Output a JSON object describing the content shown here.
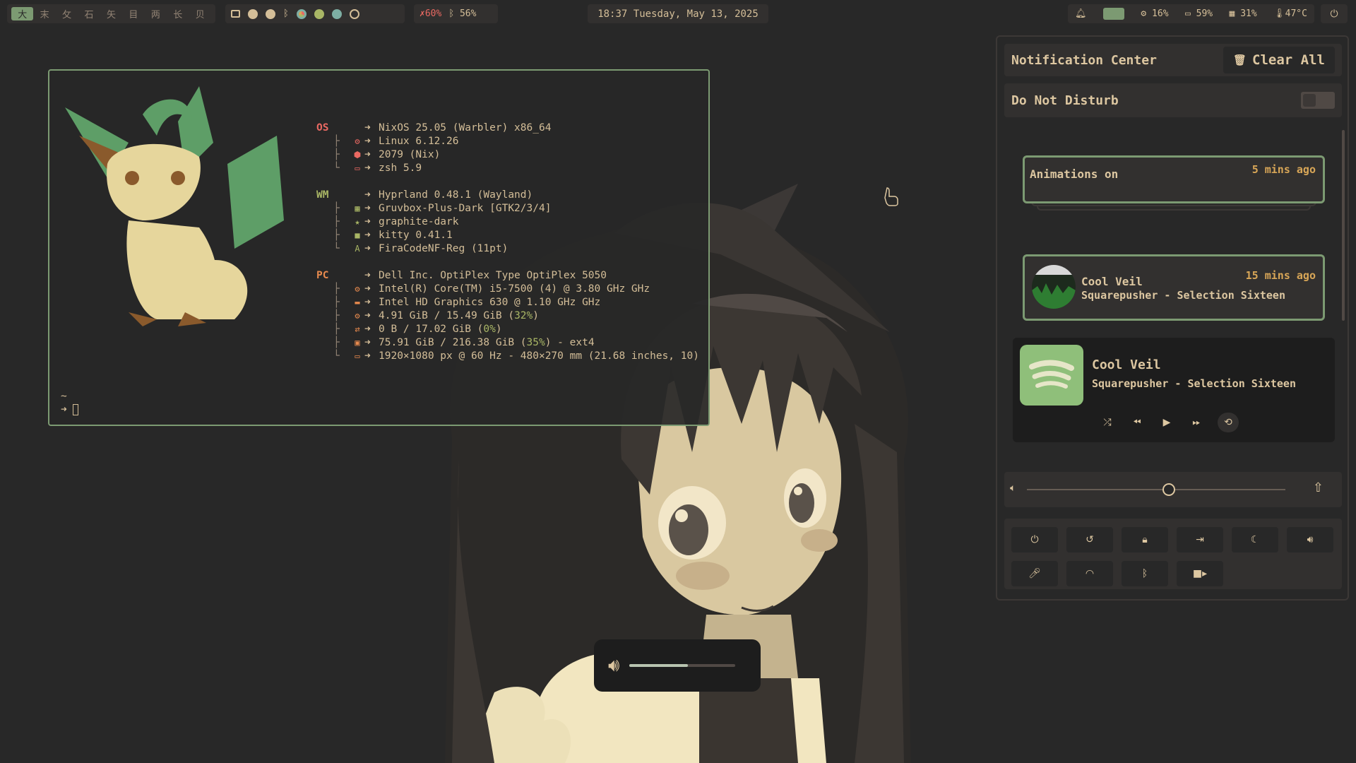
{
  "topbar": {
    "workspaces": [
      "大",
      "末",
      "攵",
      "石",
      "矢",
      "目",
      "两",
      "长",
      "贝"
    ],
    "active_workspace": 0,
    "tray_icons": [
      "window-icon",
      "obs-icon",
      "github-icon",
      "bluetooth-icon",
      "chrome-icon",
      "spotify-icon",
      "network-icon",
      "steam-icon"
    ],
    "mic_percent": "60%",
    "bluetooth_percent": "56%",
    "clock": "18:37 Tuesday, May 13, 2025",
    "cpu": "16%",
    "disk": "59%",
    "memory": "31%",
    "temperature": "47°C",
    "colors": {
      "accent": "#7c9a72",
      "mic_muted": "#ea6962"
    }
  },
  "terminal": {
    "sections": [
      {
        "key": "OS",
        "rows": [
          {
            "icon": "",
            "value": "NixOS 25.05 (Warbler) x86_64"
          },
          {
            "icon": "⚙",
            "value": "Linux 6.12.26"
          },
          {
            "icon": "⬢",
            "value": "2079 (Nix)"
          },
          {
            "icon": "▭",
            "value": "zsh 5.9"
          }
        ]
      },
      {
        "key": "WM",
        "rows": [
          {
            "icon": "",
            "value": "Hyprland 0.48.1 (Wayland)"
          },
          {
            "icon": "▦",
            "value": "Gruvbox-Plus-Dark [GTK2/3/4]"
          },
          {
            "icon": "★",
            "value": "graphite-dark"
          },
          {
            "icon": "■",
            "value": "kitty 0.41.1"
          },
          {
            "icon": "A",
            "value": "FiraCodeNF-Reg (11pt)"
          }
        ]
      },
      {
        "key": "PC",
        "rows": [
          {
            "icon": "",
            "value": "Dell Inc. OptiPlex Type OptiPlex 5050"
          },
          {
            "icon": "⚙",
            "value": "Intel(R) Core(TM) i5-7500 (4) @ 3.80 GHz GHz"
          },
          {
            "icon": "▬",
            "value": "Intel HD Graphics 630 @ 1.10 GHz GHz"
          },
          {
            "icon": "⚙",
            "value_pre": "4.91 GiB / 15.49 GiB (",
            "value_hl": "32%",
            "value_post": ")"
          },
          {
            "icon": "⇄",
            "value_pre": "0 B / 17.02 GiB (",
            "value_hl": "0%",
            "value_post": ")"
          },
          {
            "icon": "▣",
            "value_pre": "75.91 GiB / 216.38 GiB (",
            "value_hl": "35%",
            "value_post": ") - ext4"
          },
          {
            "icon": "▭",
            "value": "1920×1080 px @ 60 Hz - 480×270 mm (21.68 inches, 10)"
          }
        ]
      }
    ],
    "prompt_dir": "~",
    "prompt_symbol": "➜"
  },
  "osd": {
    "volume_fraction": 0.55
  },
  "notification_center": {
    "title": "Notification Center",
    "clear_all": "Clear All",
    "dnd_label": "Do Not Disturb",
    "dnd_on": false,
    "notifications": [
      {
        "title": "Animations on",
        "time": "5 mins ago",
        "body": ""
      },
      {
        "title": "Cool Veil",
        "time": "15 mins ago",
        "body": "Squarepusher - Selection Sixteen"
      }
    ],
    "player": {
      "title": "Cool Veil",
      "artist": "Squarepusher - Selection Sixteen",
      "controls": [
        "shuffle-icon",
        "previous-icon",
        "play-icon",
        "next-icon",
        "repeat-icon"
      ]
    },
    "volume_fraction": 0.55,
    "quick_buttons": [
      "power-icon",
      "restart-icon",
      "lock-icon",
      "logout-icon",
      "moon-icon",
      "speaker-icon",
      "microphone-icon",
      "wifi-icon",
      "bluetooth-icon",
      "camera-icon"
    ]
  }
}
